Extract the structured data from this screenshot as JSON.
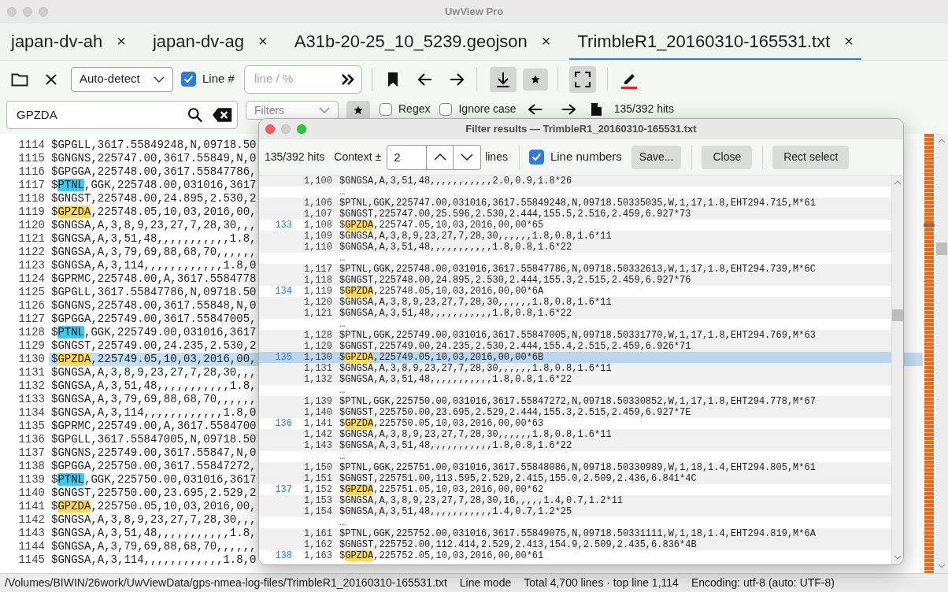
{
  "window": {
    "title": "UwView Pro"
  },
  "tabs": [
    {
      "label": "japan-dv-ah",
      "close": "×",
      "selected": false
    },
    {
      "label": "japan-dv-ag",
      "close": "×",
      "selected": false
    },
    {
      "label": "A31b-20-25_10_5239.geojson",
      "close": "×",
      "selected": false
    },
    {
      "label": "TrimbleR1_20160310-165531.txt",
      "close": "×",
      "selected": true
    }
  ],
  "toolbar": {
    "encoding": "Auto-detect",
    "line_numbers": {
      "label": "Line #",
      "checked": true
    },
    "goto": {
      "placeholder": "line / %"
    }
  },
  "search": {
    "value": "GPZDA",
    "filters": {
      "placeholder": "Filters"
    },
    "regex": {
      "label": "Regex",
      "checked": false
    },
    "ignore_case": {
      "label": "Ignore case",
      "checked": false
    },
    "hits": "135/392 hits"
  },
  "editor": {
    "lines": [
      {
        "num": "1114",
        "text": "$GPGLL,3617.55849248,N,09718.50",
        "selected": false
      },
      {
        "num": "1115",
        "text": "$GNGNS,225747.00,3617.55849,N,0",
        "selected": false
      },
      {
        "num": "1116",
        "text": "$GPGGA,225748.00,3617.55847786,",
        "selected": false
      },
      {
        "num": "1117",
        "pre": "$",
        "match": "PTNL",
        "color": "#3fc8ee",
        "post": ",GGK,225748.00,031016,3617",
        "selected": false
      },
      {
        "num": "1118",
        "text": "$GNGST,225748.00,24.895,2.530,2",
        "selected": false
      },
      {
        "num": "1119",
        "pre": "$",
        "match": "GPZDA",
        "color": "#fcd95b",
        "post": ",225748.05,10,03,2016,00,",
        "selected": false
      },
      {
        "num": "1120",
        "text": "$GNGSA,A,3,8,9,23,27,7,28,30,,,",
        "selected": false
      },
      {
        "num": "1121",
        "text": "$GNGSA,A,3,51,48,,,,,,,,,,,1.8,",
        "selected": false
      },
      {
        "num": "1122",
        "text": "$GNGSA,A,3,79,69,88,68,70,,,,,,",
        "selected": false
      },
      {
        "num": "1123",
        "text": "$GNGSA,A,3,114,,,,,,,,,,,,1.8,0",
        "selected": false
      },
      {
        "num": "1124",
        "text": "$GPRMC,225748.00,A,3617.5584778",
        "selected": false
      },
      {
        "num": "1125",
        "text": "$GPGLL,3617.55847786,N,09718.50",
        "selected": false
      },
      {
        "num": "1126",
        "text": "$GNGNS,225748.00,3617.55848,N,0",
        "selected": false
      },
      {
        "num": "1127",
        "text": "$GPGGA,225749.00,3617.55847005,",
        "selected": false
      },
      {
        "num": "1128",
        "pre": "$",
        "match": "PTNL",
        "color": "#3fc8ee",
        "post": ",GGK,225749.00,031016,3617",
        "selected": false
      },
      {
        "num": "1129",
        "text": "$GNGST,225749.00,24.235,2.530,2",
        "selected": false
      },
      {
        "num": "1130",
        "pre": "$",
        "match": "GPZDA",
        "color": "#fcd95b",
        "post": ",225749.05,10,03,2016,00,",
        "selected": true
      },
      {
        "num": "1131",
        "text": "$GNGSA,A,3,8,9,23,27,7,28,30,,,",
        "selected": false
      },
      {
        "num": "1132",
        "text": "$GNGSA,A,3,51,48,,,,,,,,,,,1.8,",
        "selected": false
      },
      {
        "num": "1133",
        "text": "$GNGSA,A,3,79,69,88,68,70,,,,,,",
        "selected": false
      },
      {
        "num": "1134",
        "text": "$GNGSA,A,3,114,,,,,,,,,,,,1.8,0",
        "selected": false
      },
      {
        "num": "1135",
        "text": "$GPRMC,225749.00,A,3617.5584700",
        "selected": false
      },
      {
        "num": "1136",
        "text": "$GPGLL,3617.55847005,N,09718.50",
        "selected": false
      },
      {
        "num": "1137",
        "text": "$GNGNS,225749.00,3617.55847,N,0",
        "selected": false
      },
      {
        "num": "1138",
        "text": "$GPGGA,225750.00,3617.55847272,",
        "selected": false
      },
      {
        "num": "1139",
        "pre": "$",
        "match": "PTNL",
        "color": "#3fc8ee",
        "post": ",GGK,225750.00,031016,3617",
        "selected": false
      },
      {
        "num": "1140",
        "text": "$GNGST,225750.00,23.695,2.529,2",
        "selected": false
      },
      {
        "num": "1141",
        "pre": "$",
        "match": "GPZDA",
        "color": "#fcd95b",
        "post": ",225750.05,10,03,2016,00,",
        "selected": false
      },
      {
        "num": "1142",
        "text": "$GNGSA,A,3,8,9,23,27,7,28,30,,,",
        "selected": false
      },
      {
        "num": "1143",
        "text": "$GNGSA,A,3,51,48,,,,,,,,,,,1.8,",
        "selected": false
      },
      {
        "num": "1144",
        "text": "$GNGSA,A,3,79,69,88,68,70,,,,,,",
        "selected": false
      },
      {
        "num": "1145",
        "text": "$GNGSA,A,3,114,,,,,,,,,,,,1.8,0",
        "selected": false
      }
    ]
  },
  "filter_dialog": {
    "title": "Filter results — TrimbleR1_20160310-165531.txt",
    "hits": "135/392 hits",
    "context_label": "Context ±",
    "context_value": "2",
    "lines_label": "lines",
    "line_numbers": {
      "label": "Line numbers",
      "checked": true
    },
    "buttons": [
      "Save...",
      "Close",
      "Rect select"
    ],
    "rows": [
      {
        "kind": "context",
        "line": "1,100",
        "text": "$GNGSA,A,3,51,48,,,,,,,,,,,2.0,0.9,1.8*26"
      },
      {
        "kind": "gap",
        "text": "…"
      },
      {
        "kind": "context",
        "line": "1,106",
        "text": "$PTNL,GGK,225747.00,031016,3617.55849248,N,09718.50335035,W,1,17,1.8,EHT294.715,M*61"
      },
      {
        "kind": "context",
        "line": "1,107",
        "text": "$GNGST,225747.00,25.596,2.530,2.444,155.5,2.516,2.459,6.927*73"
      },
      {
        "kind": "hit",
        "hit": "133",
        "line": "1,108",
        "pre": "$",
        "match": "GPZDA",
        "post": ",225747.05,10,03,2016,00,00*65",
        "selected": false
      },
      {
        "kind": "context",
        "line": "1,109",
        "text": "$GNGSA,A,3,8,9,23,27,7,28,30,,,,,,1.8,0.8,1.6*11"
      },
      {
        "kind": "context",
        "line": "1,110",
        "text": "$GNGSA,A,3,51,48,,,,,,,,,,,1.8,0.8,1.6*22"
      },
      {
        "kind": "gap",
        "text": "…"
      },
      {
        "kind": "context",
        "line": "1,117",
        "text": "$PTNL,GGK,225748.00,031016,3617.55847786,N,09718.50332613,W,1,17,1.8,EHT294.739,M*6C"
      },
      {
        "kind": "context",
        "line": "1,118",
        "text": "$GNGST,225748.00,24.895,2.530,2.444,155.3,2.515,2.459,6.927*76"
      },
      {
        "kind": "hit",
        "hit": "134",
        "line": "1,119",
        "pre": "$",
        "match": "GPZDA",
        "post": ",225748.05,10,03,2016,00,00*6A",
        "selected": false
      },
      {
        "kind": "context",
        "line": "1,120",
        "text": "$GNGSA,A,3,8,9,23,27,7,28,30,,,,,,1.8,0.8,1.6*11"
      },
      {
        "kind": "context",
        "line": "1,121",
        "text": "$GNGSA,A,3,51,48,,,,,,,,,,,1.8,0.8,1.6*22"
      },
      {
        "kind": "gap",
        "text": "…"
      },
      {
        "kind": "context",
        "line": "1,128",
        "text": "$PTNL,GGK,225749.00,031016,3617.55847005,N,09718.50331770,W,1,17,1.8,EHT294.769,M*63"
      },
      {
        "kind": "context",
        "line": "1,129",
        "text": "$GNGST,225749.00,24.235,2.530,2.444,155.4,2.515,2.459,6.926*71"
      },
      {
        "kind": "hit",
        "hit": "135",
        "line": "1,130",
        "pre": "$",
        "match": "GPZDA",
        "post": ",225749.05,10,03,2016,00,00*6B",
        "selected": true
      },
      {
        "kind": "context",
        "line": "1,131",
        "text": "$GNGSA,A,3,8,9,23,27,7,28,30,,,,,,1.8,0.8,1.6*11"
      },
      {
        "kind": "context",
        "line": "1,132",
        "text": "$GNGSA,A,3,51,48,,,,,,,,,,,1.8,0.8,1.6*22"
      },
      {
        "kind": "gap",
        "text": "…"
      },
      {
        "kind": "context",
        "line": "1,139",
        "text": "$PTNL,GGK,225750.00,031016,3617.55847272,N,09718.50330852,W,1,17,1.8,EHT294.778,M*67"
      },
      {
        "kind": "context",
        "line": "1,140",
        "text": "$GNGST,225750.00,23.695,2.529,2.444,155.3,2.515,2.459,6.927*7E"
      },
      {
        "kind": "hit",
        "hit": "136",
        "line": "1,141",
        "pre": "$",
        "match": "GPZDA",
        "post": ",225750.05,10,03,2016,00,00*63",
        "selected": false
      },
      {
        "kind": "context",
        "line": "1,142",
        "text": "$GNGSA,A,3,8,9,23,27,7,28,30,,,,,,1.8,0.8,1.6*11"
      },
      {
        "kind": "context",
        "line": "1,143",
        "text": "$GNGSA,A,3,51,48,,,,,,,,,,,1.8,0.8,1.6*22"
      },
      {
        "kind": "gap",
        "text": "…"
      },
      {
        "kind": "context",
        "line": "1,150",
        "text": "$PTNL,GGK,225751.00,031016,3617.55848086,N,09718.50330989,W,1,18,1.4,EHT294.805,M*61"
      },
      {
        "kind": "context",
        "line": "1,151",
        "text": "$GNGST,225751.00,113.595,2.529,2.415,155.0,2.509,2.436,6.841*4C"
      },
      {
        "kind": "hit",
        "hit": "137",
        "line": "1,152",
        "pre": "$",
        "match": "GPZDA",
        "post": ",225751.05,10,03,2016,00,00*62",
        "selected": false
      },
      {
        "kind": "context",
        "line": "1,153",
        "text": "$GNGSA,A,3,8,9,23,27,7,28,30,16,,,,,1.4,0.7,1.2*11"
      },
      {
        "kind": "context",
        "line": "1,154",
        "text": "$GNGSA,A,3,51,48,,,,,,,,,,,1.4,0.7,1.2*25"
      },
      {
        "kind": "gap",
        "text": "…"
      },
      {
        "kind": "context",
        "line": "1,161",
        "text": "$PTNL,GGK,225752.00,031016,3617.55849075,N,09718.50331111,W,1,18,1.4,EHT294.819,M*6A"
      },
      {
        "kind": "context",
        "line": "1,162",
        "text": "$GNGST,225752.00,112.414,2.529,2.413,154.9,2.509,2.435,6.836*4B"
      },
      {
        "kind": "hit",
        "hit": "138",
        "line": "1,163",
        "pre": "$",
        "match": "GPZDA",
        "post": ",225752.05,10,03,2016,00,00*61",
        "selected": false
      }
    ]
  },
  "status_bar": {
    "path": "/Volumes/BIWIN/26work/UwViewData/gps-nmea-log-files/TrimbleR1_20160310-165531.txt",
    "mode": "Line mode",
    "info": "Total 4,700 lines · top line 1,114",
    "encoding": "Encoding: utf-8 (auto: UTF-8)"
  }
}
